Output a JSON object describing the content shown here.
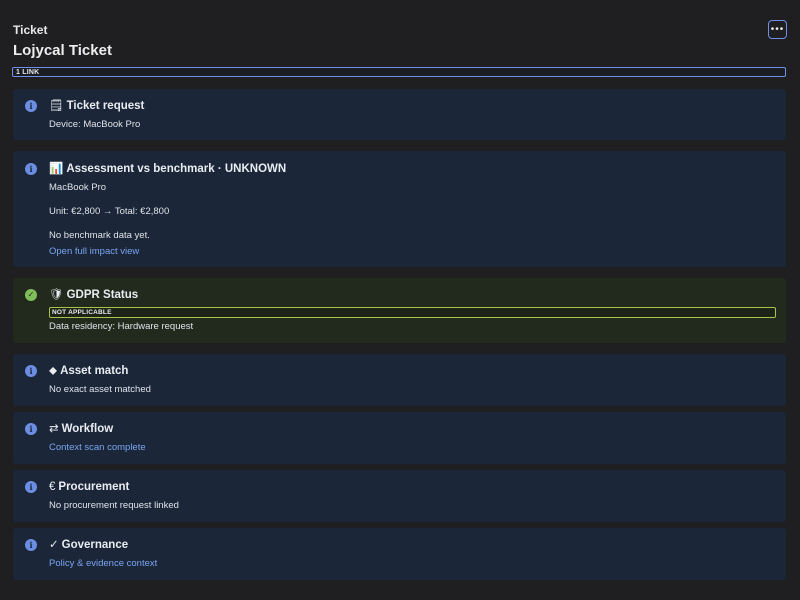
{
  "header": {
    "kicker": "Ticket",
    "title": "Lojycal Ticket",
    "more_icon": "ellipsis-icon",
    "link_bar_label": "1 LINK"
  },
  "cards": {
    "ticket_request": {
      "icon": "info-icon",
      "glyph": "🗒",
      "title": "Ticket request",
      "device_line": "Device: MacBook Pro"
    },
    "assessment": {
      "icon": "info-icon",
      "glyph": "📊",
      "title": "Assessment vs benchmark · UNKNOWN",
      "product": "MacBook Pro",
      "pricing": "Unit: €2,800 → Total: €2,800",
      "note": "No benchmark data yet.",
      "link": "Open full impact view"
    },
    "gdpr": {
      "icon": "check-circle-icon",
      "glyph": "🛡",
      "title": "GDPR Status",
      "status": "NOT APPLICABLE",
      "residency": "Data residency: Hardware request",
      "accent": "#a7c34a"
    },
    "asset_match": {
      "icon": "info-icon",
      "glyph": "⬥",
      "title": "Asset match",
      "text": "No exact asset matched"
    },
    "workflow": {
      "icon": "info-icon",
      "glyph": "⇄",
      "title": "Workflow",
      "link": "Context scan complete"
    },
    "procurement": {
      "icon": "info-icon",
      "glyph": "€",
      "title": "Procurement",
      "text": "No procurement request linked"
    },
    "governance": {
      "icon": "info-icon",
      "glyph": "✓",
      "title": "Governance",
      "link": "Policy & evidence context"
    }
  },
  "colors": {
    "background": "#1f1f21",
    "card_info": "#1b2638",
    "card_ok": "#222a1d",
    "accent_blue": "#6f8fe8",
    "link": "#79a6f2"
  }
}
